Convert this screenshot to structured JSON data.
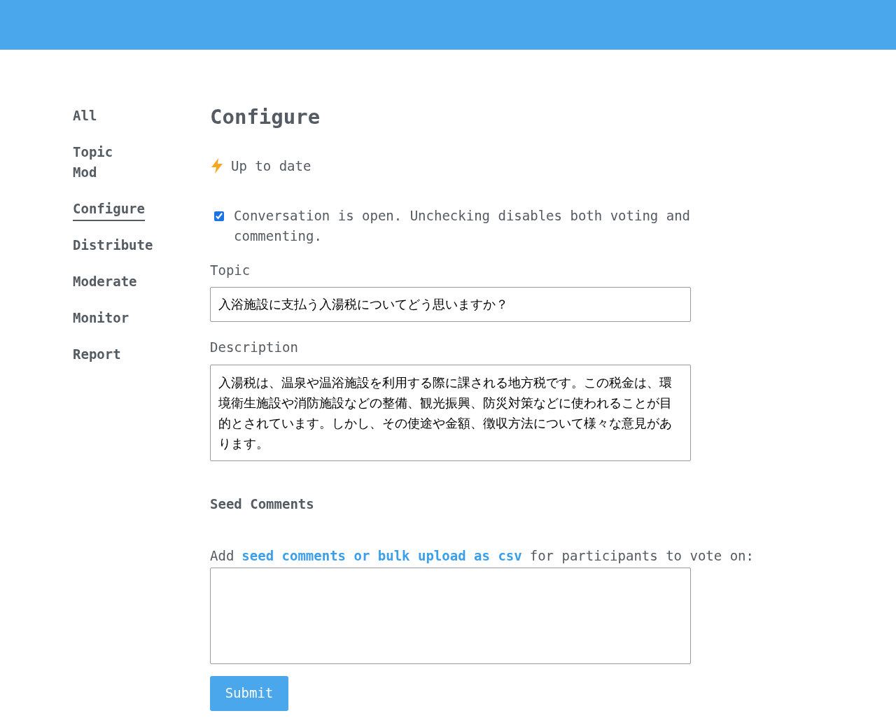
{
  "sidebar": {
    "items": [
      {
        "label": "All",
        "selected": false
      },
      {
        "label": "Topic Mod",
        "selected": false
      },
      {
        "label": "Configure",
        "selected": true
      },
      {
        "label": "Distribute",
        "selected": false
      },
      {
        "label": "Moderate",
        "selected": false
      },
      {
        "label": "Monitor",
        "selected": false
      },
      {
        "label": "Report",
        "selected": false
      }
    ]
  },
  "title": "Configure",
  "status": "Up to date",
  "open_checkbox": {
    "label": "Conversation is open. Unchecking disables both voting and commenting.",
    "checked": true
  },
  "topic": {
    "label": "Topic",
    "value": "入浴施設に支払う入湯税についてどう思いますか？"
  },
  "description": {
    "label": "Description",
    "value": "入湯税は、温泉や温浴施設を利用する際に課される地方税です。この税金は、環境衛生施設や消防施設などの整備、観光振興、防災対策などに使われることが目的とされています。しかし、その使途や金額、徴収方法について様々な意見があります。"
  },
  "seed": {
    "heading": "Seed Comments",
    "prompt_before": "Add",
    "link": "seed comments or bulk upload as csv",
    "prompt_after": "for participants to vote on:",
    "button": "Submit"
  }
}
